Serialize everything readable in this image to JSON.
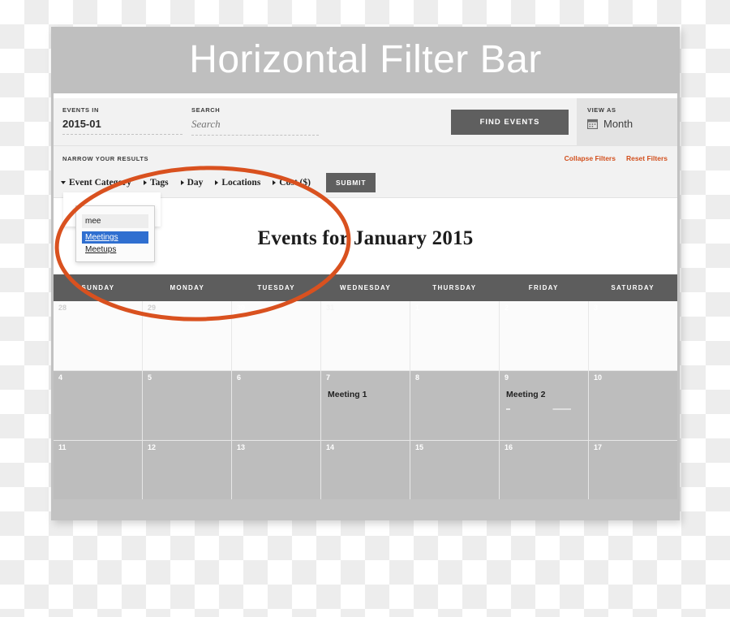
{
  "window": {
    "title": "Horizontal Filter Bar"
  },
  "findbar": {
    "events_in_label": "EVENTS IN",
    "events_in_value": "2015-01",
    "search_label": "SEARCH",
    "search_placeholder": "Search",
    "search_value": "",
    "find_button": "FIND EVENTS",
    "view_as_label": "VIEW AS",
    "view_as_value": "Month",
    "view_as_icon": "calendar-icon"
  },
  "narrowbar": {
    "title": "NARROW YOUR RESULTS",
    "collapse_filters": "Collapse Filters",
    "reset_filters": "Reset Filters",
    "submit_button": "SUBMIT",
    "filters": [
      {
        "label": "Event Category",
        "expanded": true
      },
      {
        "label": "Tags",
        "expanded": false
      },
      {
        "label": "Day",
        "expanded": false
      },
      {
        "label": "Locations",
        "expanded": false
      },
      {
        "label": "Cost ($)",
        "expanded": false
      }
    ]
  },
  "autocomplete": {
    "input_value": "mee",
    "options": [
      {
        "label": "Meetings",
        "selected": true
      },
      {
        "label": "Meetups",
        "selected": false
      }
    ]
  },
  "calendar": {
    "heading": "Events for January 2015",
    "day_headers": [
      "SUNDAY",
      "MONDAY",
      "TUESDAY",
      "WEDNESDAY",
      "THURSDAY",
      "FRIDAY",
      "SATURDAY"
    ],
    "weeks": [
      [
        {
          "day": "28",
          "state": "faded",
          "events": []
        },
        {
          "day": "29",
          "state": "faded",
          "events": []
        },
        {
          "day": "30",
          "state": "today",
          "events": []
        },
        {
          "day": "31",
          "state": "light",
          "events": []
        },
        {
          "day": "1",
          "state": "normal",
          "events": []
        },
        {
          "day": "2",
          "state": "normal",
          "events": []
        },
        {
          "day": "3",
          "state": "normal",
          "events": []
        }
      ],
      [
        {
          "day": "4",
          "state": "normal",
          "events": []
        },
        {
          "day": "5",
          "state": "normal",
          "events": []
        },
        {
          "day": "6",
          "state": "normal",
          "events": []
        },
        {
          "day": "7",
          "state": "normal",
          "events": [
            "Meeting 1"
          ]
        },
        {
          "day": "8",
          "state": "normal",
          "events": []
        },
        {
          "day": "9",
          "state": "normal",
          "events": [
            "Meeting 2"
          ]
        },
        {
          "day": "10",
          "state": "normal",
          "events": []
        }
      ],
      [
        {
          "day": "11",
          "state": "normal",
          "events": []
        },
        {
          "day": "12",
          "state": "normal",
          "events": []
        },
        {
          "day": "13",
          "state": "normal",
          "events": []
        },
        {
          "day": "14",
          "state": "normal",
          "events": []
        },
        {
          "day": "15",
          "state": "normal",
          "events": []
        },
        {
          "day": "16",
          "state": "normal",
          "events": []
        },
        {
          "day": "17",
          "state": "normal",
          "events": []
        }
      ]
    ]
  },
  "colors": {
    "title_band": "#bfbfbf",
    "accent_orange": "#d2501e",
    "button_dark": "#5f5f5f",
    "calendar_header": "#5d5d5d",
    "today_blue": "#a9cfe0",
    "select_blue": "#2f6fd0",
    "day_gray": "#bdbdbd"
  }
}
